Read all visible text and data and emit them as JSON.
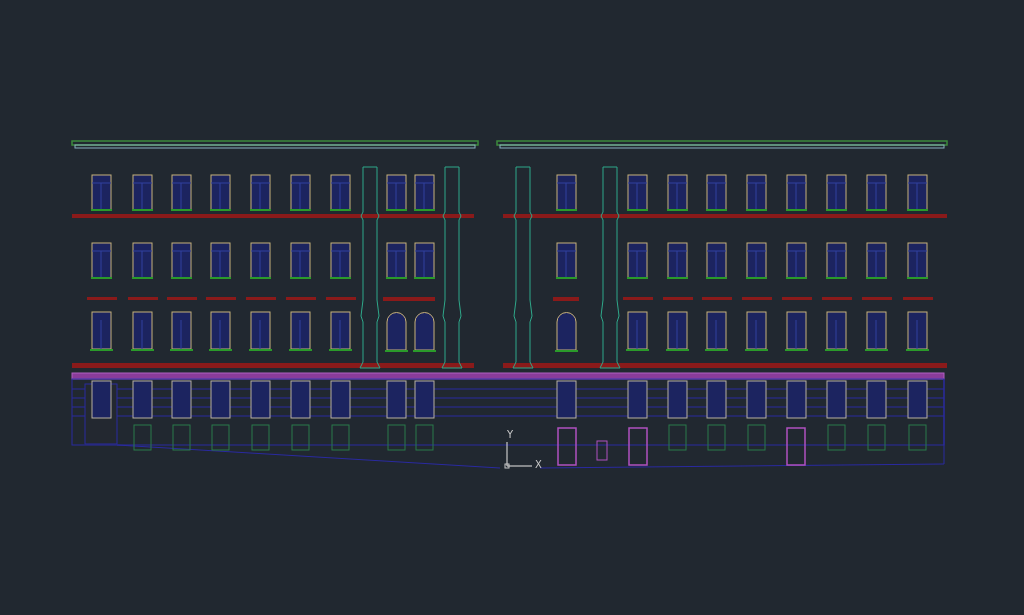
{
  "canvas": {
    "ucs_icon": {
      "y_label": "Y",
      "x_label": "X"
    }
  }
}
